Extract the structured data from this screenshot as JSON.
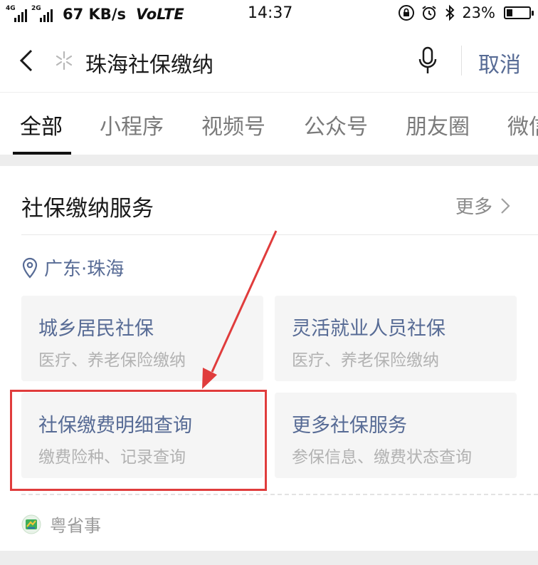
{
  "status_bar": {
    "network_top": "4G",
    "network_bottom": "2G",
    "speed": "67 KB/s",
    "volte": "VoLTE",
    "time": "14:37",
    "battery": "23%"
  },
  "search": {
    "query": "珠海社保缴纳",
    "cancel_label": "取消"
  },
  "tabs": [
    {
      "label": "全部",
      "active": true
    },
    {
      "label": "小程序"
    },
    {
      "label": "视频号"
    },
    {
      "label": "公众号"
    },
    {
      "label": "朋友圈"
    },
    {
      "label": "微信"
    }
  ],
  "card": {
    "title": "社保缴纳服务",
    "more_label": "更多",
    "location": "广东·珠海",
    "services": [
      {
        "title": "城乡居民社保",
        "subtitle": "医疗、养老保险缴纳"
      },
      {
        "title": "灵活就业人员社保",
        "subtitle": "医疗、养老保险缴纳"
      },
      {
        "title": "社保缴费明细查询",
        "subtitle": "缴费险种、记录查询"
      },
      {
        "title": "更多社保服务",
        "subtitle": "参保信息、缴费状态查询"
      }
    ],
    "source": "粤省事"
  },
  "colors": {
    "link_blue": "#576b95",
    "annotation_red": "#e03c3c",
    "background_gray": "#ededed"
  }
}
